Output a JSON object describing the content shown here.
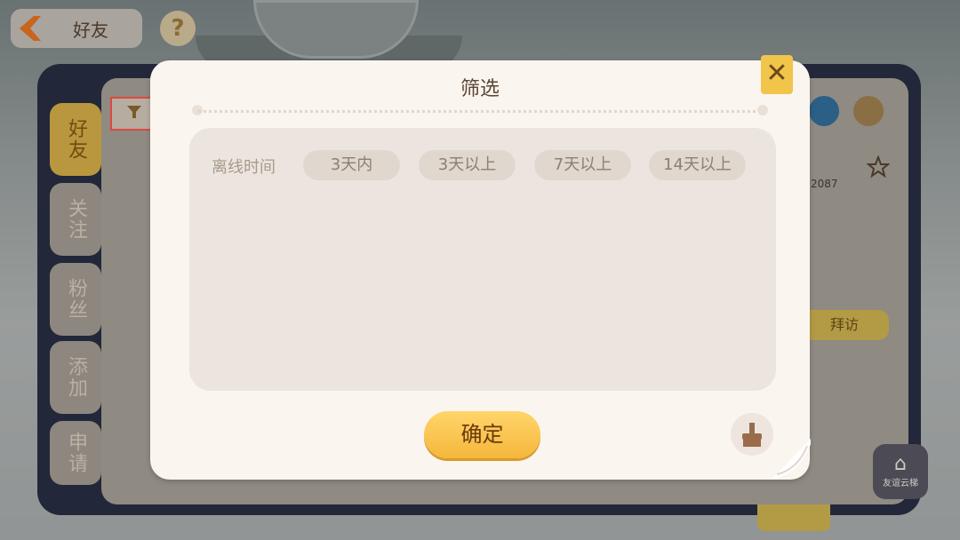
{
  "header": {
    "title": "好友",
    "help_glyph": "?"
  },
  "tabs": [
    {
      "label": "好友",
      "active": true
    },
    {
      "label": "关注",
      "active": false
    },
    {
      "label": "粉丝",
      "active": false
    },
    {
      "label": "添加",
      "active": false
    },
    {
      "label": "申请",
      "active": false
    }
  ],
  "background": {
    "id_fragment": "2087",
    "visit_label": "拜访",
    "ladder_label": "友谊云梯"
  },
  "dialog": {
    "title": "筛选",
    "close_glyph": "✕",
    "filter_label": "离线时间",
    "options": [
      "3天内",
      "3天以上",
      "7天以上",
      "14天以上"
    ],
    "confirm_label": "确定"
  },
  "colors": {
    "accent_yellow": "#f5b73c",
    "highlight_red": "#e0473f",
    "dialog_bg": "#fbf5ef"
  }
}
